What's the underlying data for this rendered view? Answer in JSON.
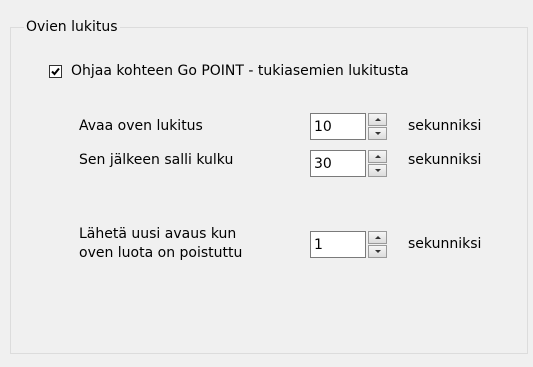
{
  "group": {
    "title": "Ovien lukitus"
  },
  "checkbox": {
    "label": "Ohjaa kohteen Go POINT - tukiasemien lukitusta",
    "checked": true
  },
  "rows": [
    {
      "label": "Avaa oven lukitus",
      "value": "10",
      "unit": "sekunniksi"
    },
    {
      "label": "Sen jälkeen salli kulku",
      "value": "30",
      "unit": "sekunniksi"
    },
    {
      "label_line1": "Lähetä uusi avaus kun",
      "label_line2": "oven luota on poistuttu",
      "value": "1",
      "unit": "sekunniksi"
    }
  ]
}
